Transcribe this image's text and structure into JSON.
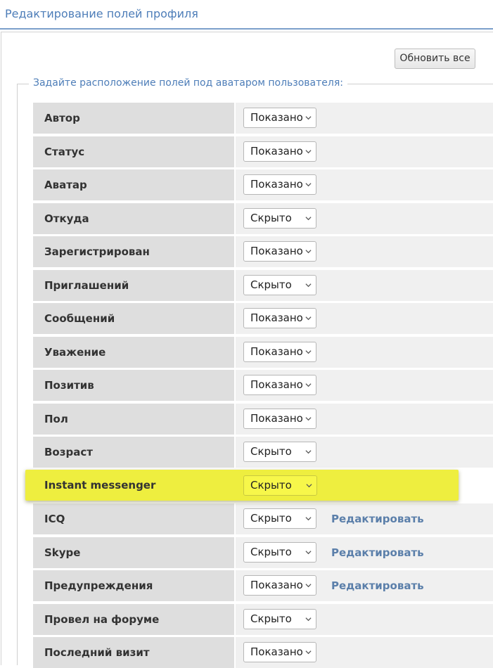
{
  "header": {
    "title": "Редактирование полей профиля"
  },
  "toolbar": {
    "update_all_label": "Обновить все"
  },
  "fieldset": {
    "legend": "Задайте расположение полей под аватаром пользователя:"
  },
  "rows": [
    {
      "label": "Автор",
      "value": "Показано",
      "edit": ""
    },
    {
      "label": "Статус",
      "value": "Показано",
      "edit": ""
    },
    {
      "label": "Аватар",
      "value": "Показано",
      "edit": ""
    },
    {
      "label": "Откуда",
      "value": "Скрыто",
      "edit": ""
    },
    {
      "label": "Зарегистрирован",
      "value": "Показано",
      "edit": ""
    },
    {
      "label": "Приглашений",
      "value": "Скрыто",
      "edit": ""
    },
    {
      "label": "Сообщений",
      "value": "Показано",
      "edit": ""
    },
    {
      "label": "Уважение",
      "value": "Показано",
      "edit": ""
    },
    {
      "label": "Позитив",
      "value": "Показано",
      "edit": ""
    },
    {
      "label": "Пол",
      "value": "Показано",
      "edit": ""
    },
    {
      "label": "Возраст",
      "value": "Скрыто",
      "edit": ""
    },
    {
      "label": "Instant messenger",
      "value": "Скрыто",
      "edit": ""
    },
    {
      "label": "ICQ",
      "value": "Скрыто",
      "edit": "Редактировать"
    },
    {
      "label": "Skype",
      "value": "Скрыто",
      "edit": "Редактировать"
    },
    {
      "label": "Предупреждения",
      "value": "Показано",
      "edit": "Редактировать"
    },
    {
      "label": "Провел на форуме",
      "value": "Скрыто",
      "edit": ""
    },
    {
      "label": "Последний визит",
      "value": "Показано",
      "edit": ""
    }
  ],
  "colors": {
    "accent_blue": "#4d7db8",
    "link_blue": "#5b7faa",
    "highlight_yellow": "#eeee3f"
  }
}
